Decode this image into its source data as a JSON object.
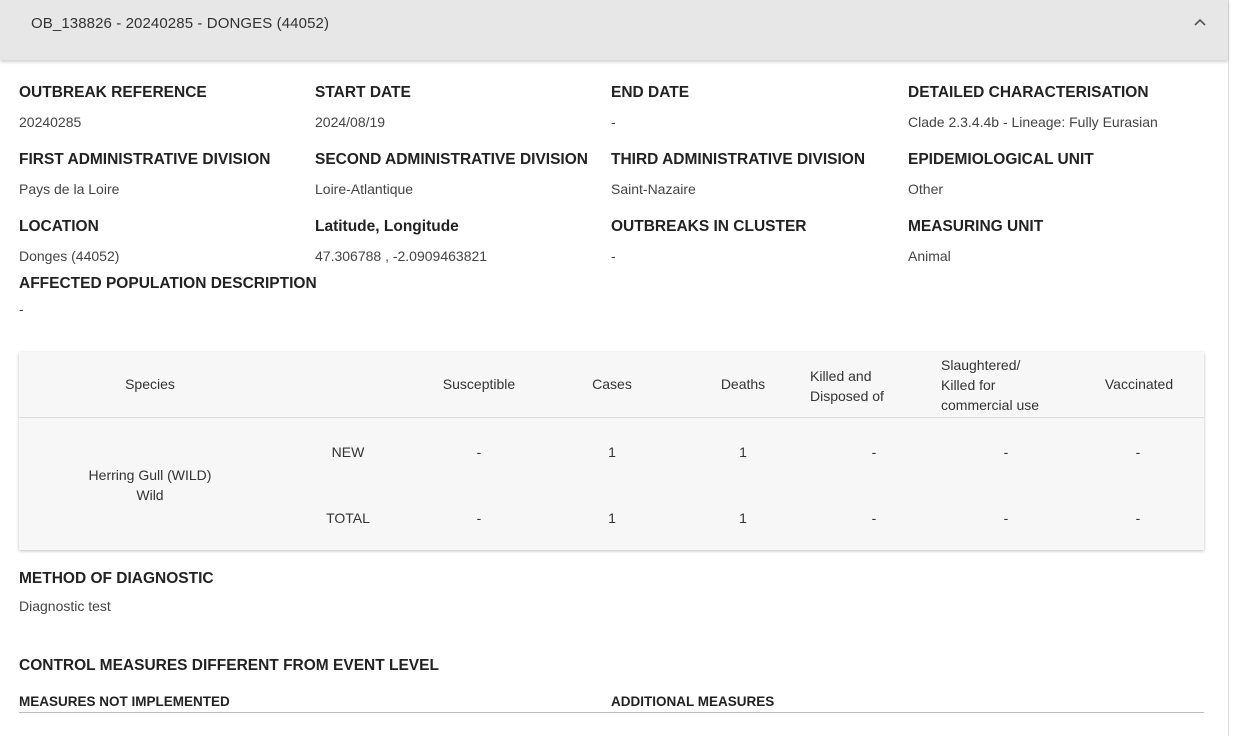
{
  "header": {
    "title": "OB_138826 - 20240285 - DONGES (44052)",
    "toggle_icon": "chevron-up-icon"
  },
  "fields": {
    "outbreak_reference": {
      "label": "OUTBREAK REFERENCE",
      "value": "20240285"
    },
    "start_date": {
      "label": "START DATE",
      "value": "2024/08/19"
    },
    "end_date": {
      "label": "END DATE",
      "value": "-"
    },
    "detailed_characterisation": {
      "label": "DETAILED CHARACTERISATION",
      "value": "Clade 2.3.4.4b - Lineage: Fully Eurasian"
    },
    "first_admin": {
      "label": "FIRST ADMINISTRATIVE DIVISION",
      "value": "Pays de la Loire"
    },
    "second_admin": {
      "label": "SECOND ADMINISTRATIVE DIVISION",
      "value": "Loire-Atlantique"
    },
    "third_admin": {
      "label": "THIRD ADMINISTRATIVE DIVISION",
      "value": "Saint-Nazaire"
    },
    "epi_unit": {
      "label": "EPIDEMIOLOGICAL UNIT",
      "value": "Other"
    },
    "location": {
      "label": "LOCATION",
      "value": "Donges (44052)"
    },
    "lat_long": {
      "label": "Latitude, Longitude",
      "value": "47.306788 , -2.0909463821"
    },
    "outbreaks_in_cluster": {
      "label": "OUTBREAKS IN CLUSTER",
      "value": "-"
    },
    "measuring_unit": {
      "label": "MEASURING UNIT",
      "value": "Animal"
    },
    "affected_population": {
      "label": "AFFECTED POPULATION DESCRIPTION",
      "value": "-"
    }
  },
  "table": {
    "headers": {
      "species": "Species",
      "susceptible": "Susceptible",
      "cases": "Cases",
      "deaths": "Deaths",
      "killed_line1": "Killed and",
      "killed_line2": "Disposed of",
      "slaughtered_line1": "Slaughtered/",
      "slaughtered_line2": "Killed for",
      "slaughtered_line3": "commercial use",
      "vaccinated": "Vaccinated"
    },
    "species_name": "Herring Gull (WILD)",
    "species_type": "Wild",
    "rows": [
      {
        "label": "NEW",
        "susceptible": "-",
        "cases": "1",
        "deaths": "1",
        "killed": "-",
        "slaughtered": "-",
        "vaccinated": "-"
      },
      {
        "label": "TOTAL",
        "susceptible": "-",
        "cases": "1",
        "deaths": "1",
        "killed": "-",
        "slaughtered": "-",
        "vaccinated": "-"
      }
    ]
  },
  "method": {
    "label": "METHOD OF DIAGNOSTIC",
    "value": "Diagnostic test"
  },
  "control": {
    "title": "CONTROL MEASURES DIFFERENT FROM EVENT LEVEL",
    "not_implemented": "MEASURES NOT IMPLEMENTED",
    "additional": "ADDITIONAL MEASURES"
  }
}
